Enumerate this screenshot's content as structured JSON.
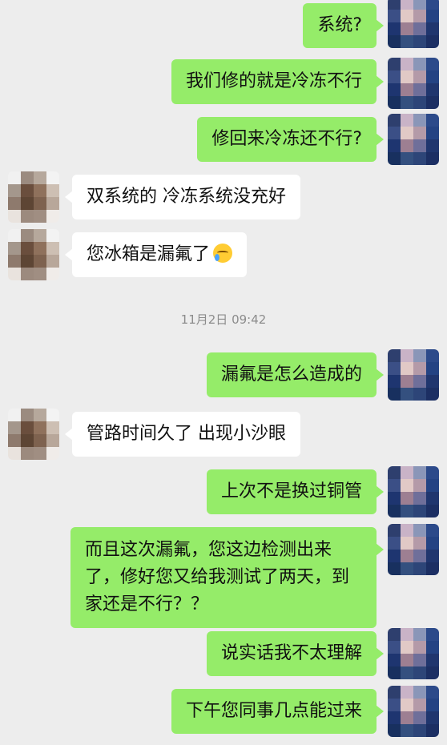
{
  "messages": [
    {
      "side": "right",
      "text": "系统?"
    },
    {
      "side": "right",
      "text": "我们修的就是冷冻不行"
    },
    {
      "side": "right",
      "text": "修回来冷冻还不行?"
    },
    {
      "side": "left",
      "text": "双系统的  冷冻系统没充好"
    },
    {
      "side": "left",
      "text": "您冰箱是漏氟了",
      "emoji": "crying-face-emoji"
    },
    {
      "side": "right",
      "text": "漏氟是怎么造成的"
    },
    {
      "side": "left",
      "text": "管路时间久了 出现小沙眼"
    },
    {
      "side": "right",
      "text": "上次不是换过铜管"
    },
    {
      "side": "right",
      "text": "而且这次漏氟，您这边检测出来了，修好您又给我测试了两天，到家还是不行？？"
    },
    {
      "side": "right",
      "text": "说实话我不太理解"
    },
    {
      "side": "right",
      "text": "下午您同事几点能过来"
    }
  ],
  "timestamp": "11月2日 09:42",
  "colors": {
    "background": "#ededed",
    "outgoing_bubble": "#95ec69",
    "incoming_bubble": "#ffffff",
    "timestamp_text": "#8c8c8c"
  }
}
